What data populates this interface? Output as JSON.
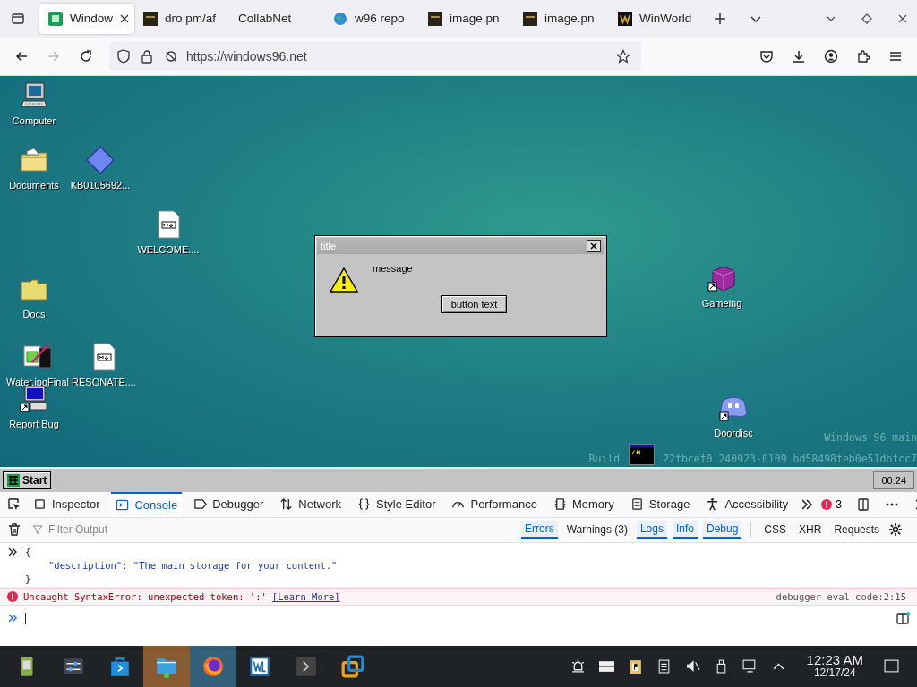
{
  "browser": {
    "tabs": [
      {
        "label": "Window",
        "selected": true
      },
      {
        "label": "dro.pm/af",
        "selected": false
      },
      {
        "label": "CollabNet",
        "selected": false
      },
      {
        "label": "w96 repo",
        "selected": false
      },
      {
        "label": "image.pn",
        "selected": false
      },
      {
        "label": "image.pn",
        "selected": false
      },
      {
        "label": "WinWorld",
        "selected": false
      }
    ],
    "url": "https://windows96.net"
  },
  "desktop": {
    "icons": [
      {
        "label": "Computer",
        "kind": "computer"
      },
      {
        "label": "Documents",
        "kind": "documents"
      },
      {
        "label": "KB0105692...",
        "kind": "diamond"
      },
      {
        "label": "WELCOME....",
        "kind": "markdown"
      },
      {
        "label": "Docs",
        "kind": "folder"
      },
      {
        "label": "Water.jpgFinal",
        "kind": "paint"
      },
      {
        "label": "RESONATE....",
        "kind": "markdown"
      },
      {
        "label": "Report Bug",
        "kind": "bug"
      },
      {
        "label": "Gameing",
        "kind": "cube"
      },
      {
        "label": "Doordisc",
        "kind": "chat"
      }
    ],
    "watermark": {
      "line_1": "Windows 96 main",
      "line_2_start": "Build",
      "line_2_end": "22fbcef0 240923-0109 bd58498feb0e51dbfcc7"
    },
    "dialog": {
      "title": "title",
      "message": "message",
      "button": "button text"
    },
    "taskbar": {
      "start": "Start",
      "clock": "00:24"
    }
  },
  "devtools": {
    "tabs": [
      {
        "label": "Inspector",
        "selected": false
      },
      {
        "label": "Console",
        "selected": true
      },
      {
        "label": "Debugger",
        "selected": false
      },
      {
        "label": "Network",
        "selected": false
      },
      {
        "label": "Style Editor",
        "selected": false
      },
      {
        "label": "Performance",
        "selected": false
      },
      {
        "label": "Memory",
        "selected": false
      },
      {
        "label": "Storage",
        "selected": false
      },
      {
        "label": "Accessibility",
        "selected": false
      }
    ],
    "error_count": "3",
    "filter": {
      "placeholder": "Filter Output"
    },
    "filters": [
      {
        "label": "Errors",
        "selected": true
      },
      {
        "label": "Warnings (3)",
        "selected": false
      },
      {
        "label": "Logs",
        "selected": true
      },
      {
        "label": "Info",
        "selected": true
      },
      {
        "label": "Debug",
        "selected": true
      },
      {
        "label": "CSS",
        "selected": false
      },
      {
        "label": "XHR",
        "selected": false
      },
      {
        "label": "Requests",
        "selected": false
      }
    ],
    "console": {
      "output": [
        "{",
        "\"description\": \"The main storage for your content.\"",
        "}"
      ],
      "error": {
        "message": "Uncaught SyntaxError: unexpected token: ':'",
        "link": "[Learn More]",
        "location": "debugger eval code:2:15"
      }
    }
  },
  "system_taskbar": {
    "apps": [
      {
        "kind": "android",
        "active": false
      },
      {
        "kind": "settings",
        "active": false
      },
      {
        "kind": "store",
        "active": false
      },
      {
        "kind": "files",
        "active": true
      },
      {
        "kind": "firefox",
        "active": true
      },
      {
        "kind": "editor",
        "active": false
      },
      {
        "kind": "terminal",
        "active": false
      },
      {
        "kind": "vm",
        "active": false
      }
    ],
    "time": "12:23 AM",
    "date": "12/17/24"
  }
}
